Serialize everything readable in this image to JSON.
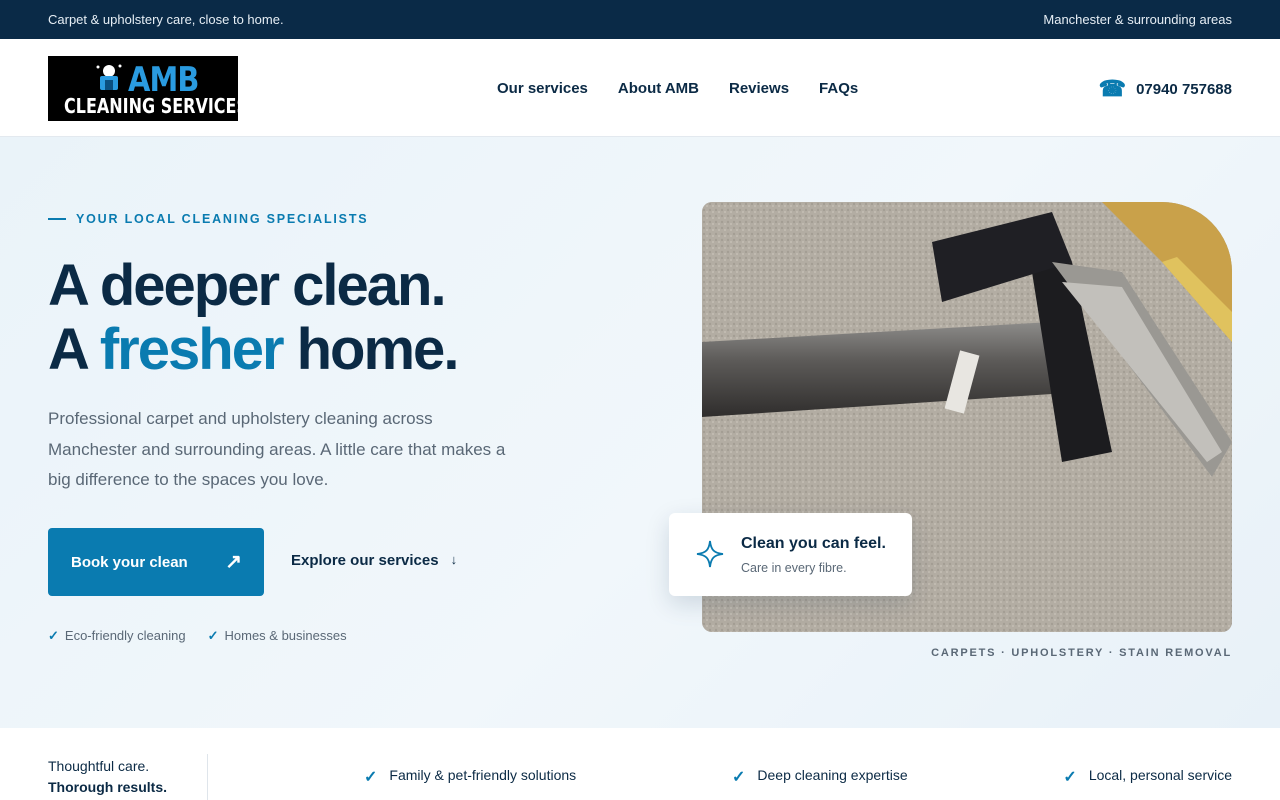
{
  "topbar": {
    "left_text": "Carpet & upholstery care, close to home.",
    "right_text": "Manchester & surrounding areas"
  },
  "header": {
    "logo": {
      "line1": "AMB",
      "line2": "CLEANING SERVICES"
    },
    "nav": [
      "Our services",
      "About AMB",
      "Reviews",
      "FAQs"
    ],
    "phone": {
      "icon": "phone-icon",
      "number": "07940 757688"
    }
  },
  "hero": {
    "eyebrow": "YOUR LOCAL CLEANING SPECIALISTS",
    "headline_line1": "A deeper clean.",
    "headline_line2_pre": "A ",
    "headline_line2_accent": "fresher",
    "headline_line2_post": " home.",
    "lede": "Professional carpet and upholstery cleaning across Manchester and surrounding areas. A little care that makes a big difference to the spaces you love.",
    "primary_button": "Book your clean",
    "primary_button_icon": "arrow-up-right-icon",
    "secondary_button": "Explore our services",
    "secondary_button_icon": "arrow-down-icon",
    "checks": [
      "Eco-friendly cleaning",
      "Homes & businesses"
    ],
    "card": {
      "icon": "sparkle-icon",
      "title": "Clean you can feel.",
      "subtitle": "Care in every fibre."
    },
    "caption": "CARPETS · UPHOLSTERY · STAIN REMOVAL"
  },
  "strip": {
    "tagline_line1": "Thoughtful care.",
    "tagline_line2": "Thorough results.",
    "features": [
      "Family & pet-friendly solutions",
      "Deep cleaning expertise",
      "Local, personal service"
    ]
  },
  "colors": {
    "navy": "#0a2a47",
    "accent": "#0a7bb0",
    "text": "#0b2a45",
    "muted": "#5a6876"
  }
}
